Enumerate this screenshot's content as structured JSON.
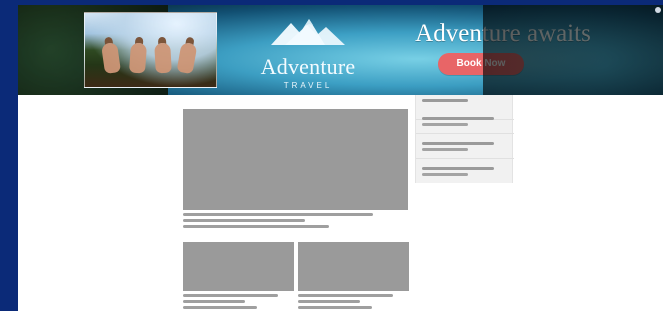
{
  "banner": {
    "brand": {
      "name": "Adventure",
      "subtitle": "TRAVEL",
      "logo_icon": "mountains-icon"
    },
    "headline": "Adventure awaits",
    "cta_label": "Book Now",
    "cta_color": "#e86567"
  },
  "content": {
    "skeleton_color": "#9a9a9a",
    "sidebar_items": [
      {
        "id": "sidebar-item-1"
      },
      {
        "id": "sidebar-item-2"
      },
      {
        "id": "sidebar-item-3"
      },
      {
        "id": "sidebar-item-4"
      }
    ]
  }
}
